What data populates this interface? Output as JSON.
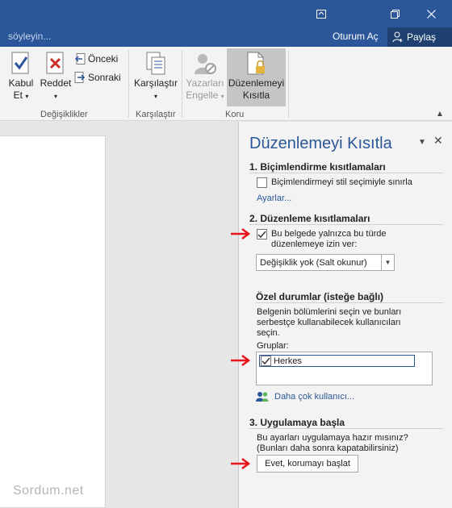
{
  "titlebar": {
    "buttons": [
      "ribbon-display-options",
      "restore",
      "close"
    ]
  },
  "tellbar": {
    "tell_me_text": "söyleyin...",
    "sign_in": "Oturum Aç",
    "share": "Paylaş"
  },
  "ribbon": {
    "changes_group": {
      "accept_line1": "Kabul",
      "accept_line2": "Et",
      "reject": "Reddet",
      "previous": "Önceki",
      "next": "Sonraki",
      "label": "Değişiklikler"
    },
    "compare_group": {
      "compare": "Karşılaştır",
      "label": "Karşılaştır"
    },
    "protect_group": {
      "block_line1": "Yazarları",
      "block_line2": "Engelle",
      "restrict_line1": "Düzenlemeyi",
      "restrict_line2": "Kısıtla",
      "label": "Koru"
    }
  },
  "watermark": "Sordum.net",
  "pane": {
    "title": "Düzenlemeyi Kısıtla",
    "section1": {
      "title": "1. Biçimlendirme kısıtlamaları",
      "checkbox_label": "Biçimlendirmeyi stil seçimiyle sınırla",
      "checked": false,
      "settings_link": "Ayarlar..."
    },
    "section2": {
      "title": "2. Düzenleme kısıtlamaları",
      "checkbox_line1": "Bu belgede yalnızca bu türde",
      "checkbox_line2": "düzenlemeye izin ver:",
      "checked": true,
      "dropdown_value": "Değişiklik yok (Salt okunur)"
    },
    "exceptions": {
      "title": "Özel durumlar (isteğe bağlı)",
      "desc_line1": "Belgenin bölümlerini seçin ve bunları",
      "desc_line2": "serbestçe kullanabilecek kullanıcıları",
      "desc_line3": "seçin.",
      "groups_label": "Gruplar:",
      "group_item": "Herkes",
      "group_checked": true,
      "more_users": "Daha çok kullanıcı..."
    },
    "section3": {
      "title": "3. Uygulamaya başla",
      "desc_line1": "Bu ayarları uygulamaya hazır mısınız?",
      "desc_line2": "(Bunları daha sonra kapatabilirsiniz)",
      "button": "Evet, korumayı başlat"
    }
  },
  "colors": {
    "brand": "#2b579a",
    "arrow": "#e8141b"
  }
}
